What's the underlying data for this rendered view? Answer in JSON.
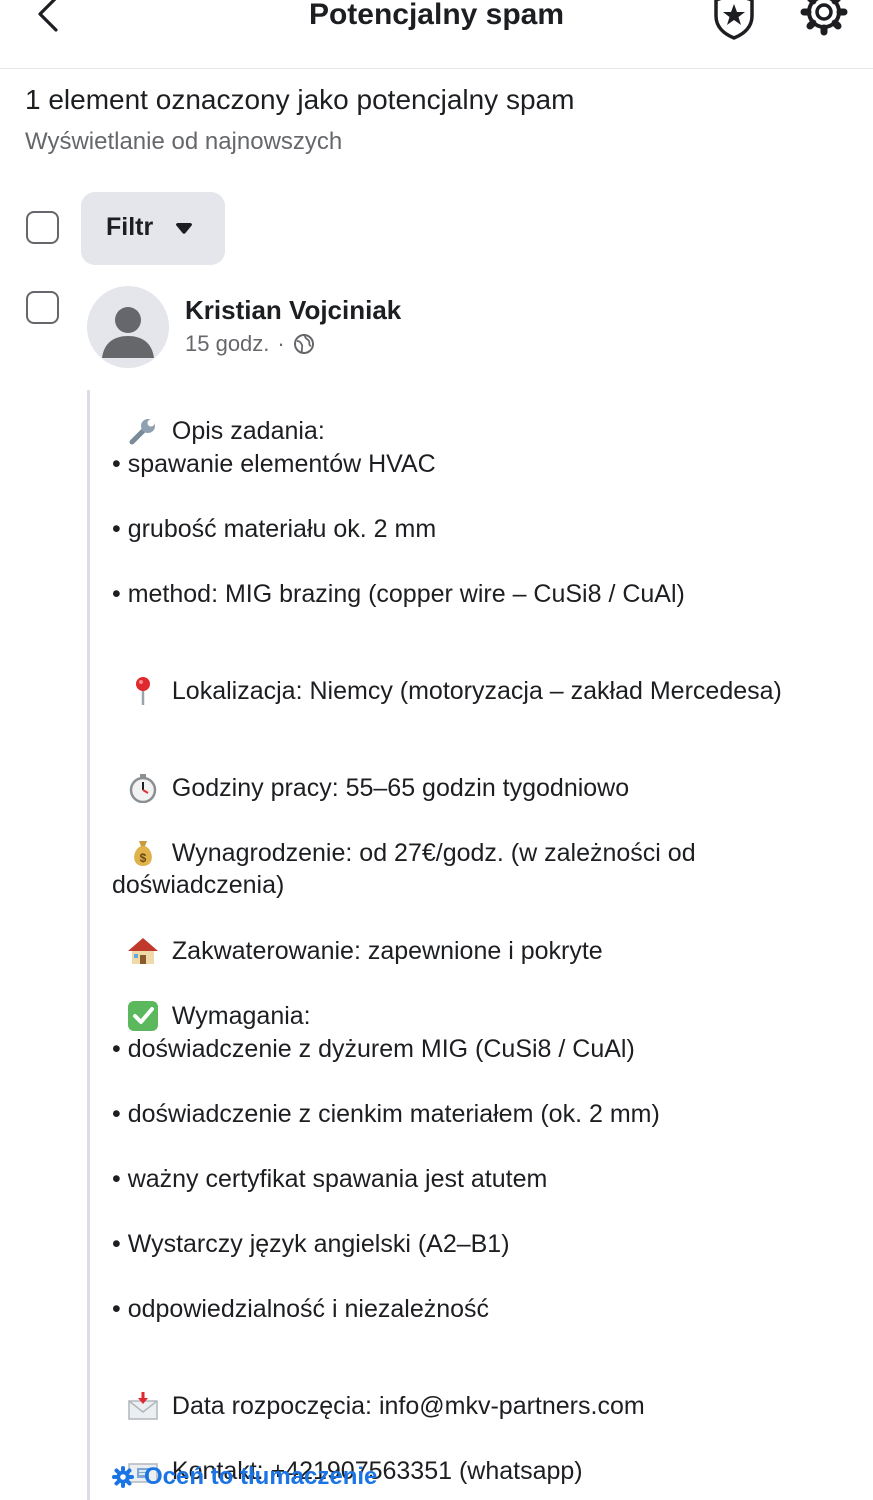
{
  "header": {
    "title": "Potencjalny spam"
  },
  "summary": {
    "heading": "1 element oznaczony jako potencjalny spam",
    "sort_label": "Wyświetlanie od najnowszych"
  },
  "toolbar": {
    "filter_label": "Filtr"
  },
  "post": {
    "author": "Kristian Vojciniak",
    "time": "15 godz.",
    "separator": "·",
    "lines": {
      "l0": "Opis zadania:",
      "l1": "• spawanie elementów HVAC",
      "l2": "• grubość materiału ok. 2 mm",
      "l3": "• method: MIG brazing (copper wire – CuSi8 / CuAl)",
      "l4": "Lokalizacja: Niemcy (motoryzacja – zakład Mercedesa)",
      "l5": "Godziny pracy: 55–65 godzin tygodniowo",
      "l6": "Wynagrodzenie: od 27€/godz. (w zależności od doświadczenia)",
      "l7": "Zakwaterowanie: zapewnione i pokryte",
      "l8": "Wymagania:",
      "l9": "• doświadczenie z dyżurem MIG (CuSi8 / CuAl)",
      "l10": "• doświadczenie z cienkim materiałem (ok. 2 mm)",
      "l11": "• ważny certyfikat spawania jest atutem",
      "l12": "• Wystarczy język angielski (A2–B1)",
      "l13": "• odpowiedzialność i niezależność",
      "l14": "Data rozpoczęcia: info@mkv-partners.com",
      "l15": "Kontakt: +421907563351 (whatsapp)"
    },
    "rate_translation": "Oceń to tłumaczenie"
  },
  "icons": {
    "back": "chevron-left-icon",
    "badge": "shield-star-icon",
    "settings": "gear-icon",
    "privacy": "globe-icon",
    "rate": "gear-icon"
  },
  "colors": {
    "link": "#1b74e4",
    "muted": "#65676b",
    "chip": "#e4e6eb"
  }
}
